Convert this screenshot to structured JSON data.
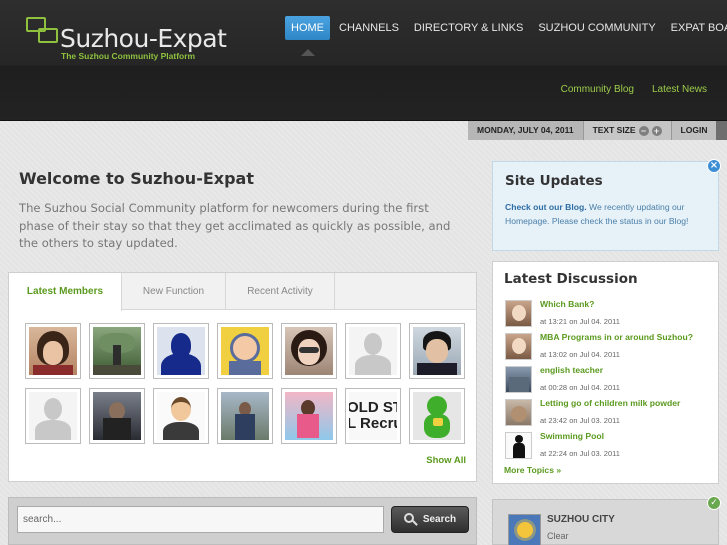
{
  "brand": {
    "title": "Suzhou-Expat",
    "tagline": "The Suzhou Community Platform"
  },
  "nav": {
    "items": [
      "HOME",
      "CHANNELS",
      "DIRECTORY & LINKS",
      "SUZHOU COMMUNITY",
      "EXPAT BOARD"
    ],
    "active": "HOME"
  },
  "subnav": {
    "items": [
      "Community Blog",
      "Latest News"
    ]
  },
  "utility": {
    "date": "MONDAY, JULY 04, 2011",
    "text_size_label": "TEXT SIZE",
    "decrease": "−",
    "increase": "+",
    "login": "LOGIN"
  },
  "welcome": {
    "title": "Welcome to Suzhou-Expat",
    "text": "The Suzhou Social Community platform for newcomers during the first phase of their stay so that they get acclimated as quickly as possible, and the others to stay updated."
  },
  "tabs": {
    "items": [
      "Latest Members",
      "New Function",
      "Recent Activity"
    ],
    "active": "Latest Members"
  },
  "members": {
    "count": 14,
    "show_all": "Show All",
    "partial_text": "OLD ST\nL Recruitm"
  },
  "search": {
    "placeholder": "search...",
    "button_label": "Search"
  },
  "site_updates": {
    "title": "Site Updates",
    "link_text": "Check out our Blog.",
    "body": " We recently updating our Homepage. Please check the status in our Blog!",
    "close_icon": "×"
  },
  "discussion": {
    "title": "Latest Discussion",
    "items": [
      {
        "title": "Which Bank?",
        "meta": "at 13:21 on Jul 04. 2011"
      },
      {
        "title": "MBA Programs in or around Suzhou?",
        "meta": "at 13:02 on Jul 04. 2011"
      },
      {
        "title": "english teacher",
        "meta": "at 00:28 on Jul 04. 2011"
      },
      {
        "title": "Letting go of children milk powder",
        "meta": "at 23:42 on Jul 03. 2011"
      },
      {
        "title": "Swimming Pool",
        "meta": "at 22:24 on Jul 03. 2011"
      }
    ],
    "more": "More Topics »"
  },
  "weather": {
    "city": "SUZHOU CITY",
    "condition": "Clear",
    "ok_icon": "✓"
  },
  "colors": {
    "accent_green": "#5a9a1e",
    "nav_active_blue": "#3a93d4",
    "header_dark": "#262626"
  }
}
